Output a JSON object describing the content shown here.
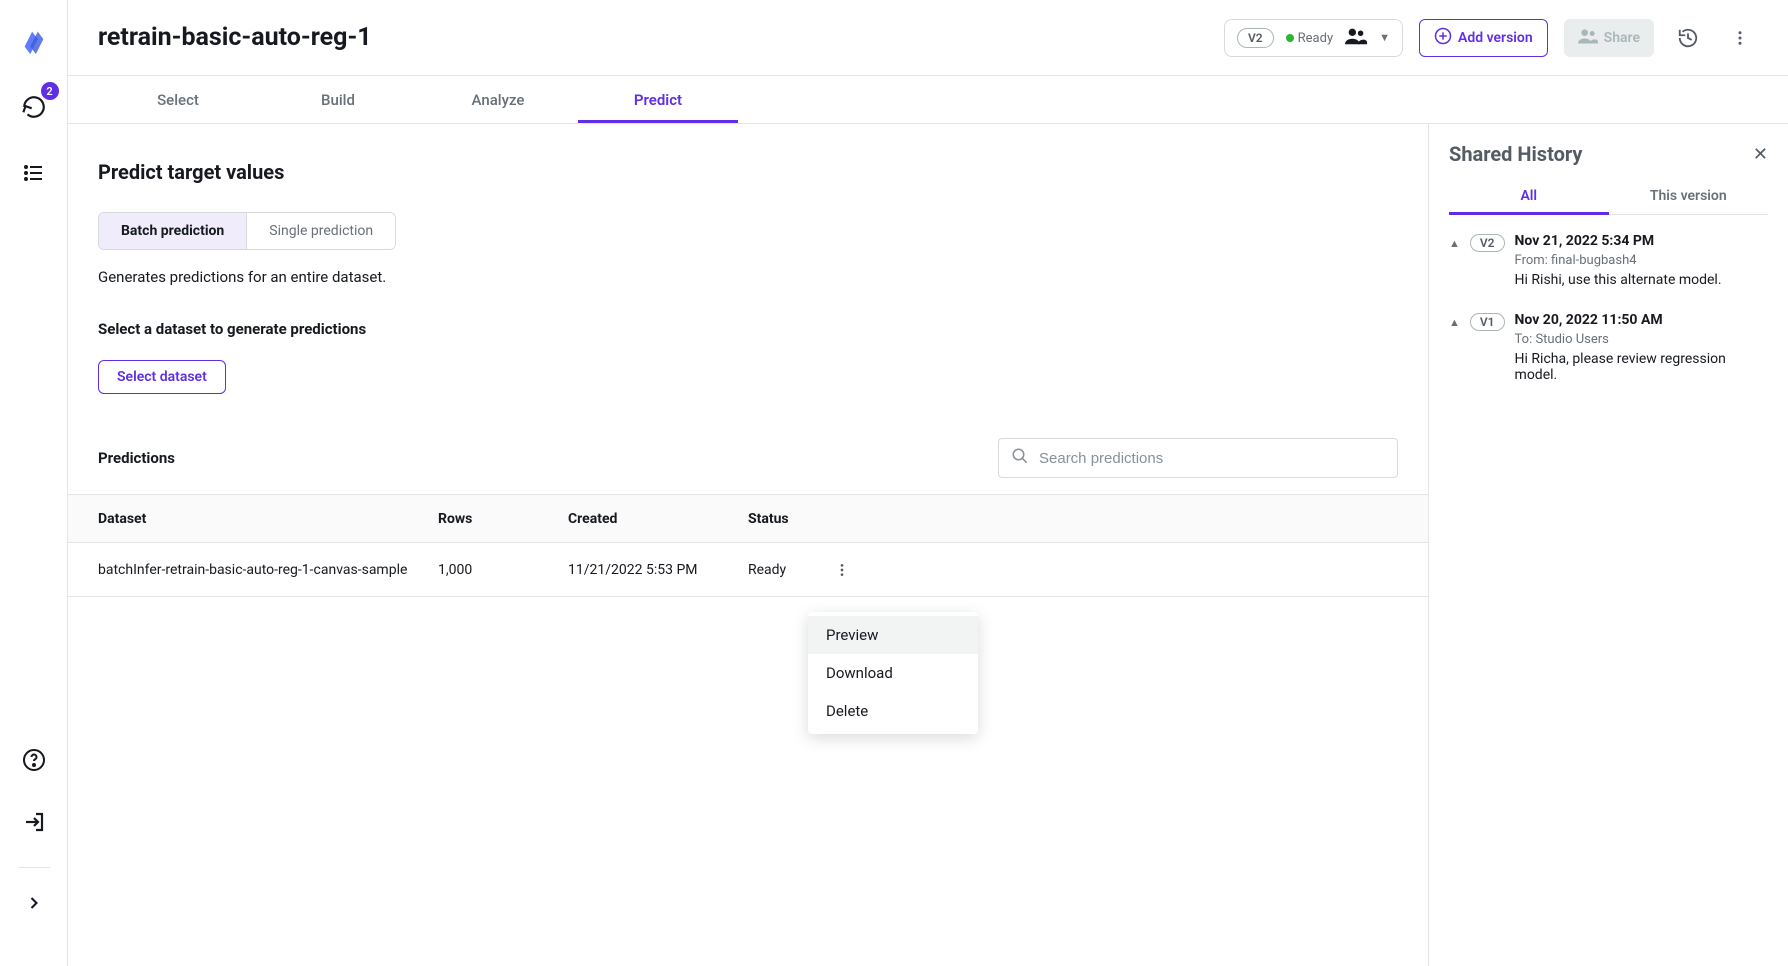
{
  "left_rail": {
    "badge": "2"
  },
  "header": {
    "title": "retrain-basic-auto-reg-1",
    "version_pill": "V2",
    "status": "Ready",
    "add_version": "Add version",
    "share": "Share"
  },
  "tabs": [
    {
      "label": "Select"
    },
    {
      "label": "Build"
    },
    {
      "label": "Analyze"
    },
    {
      "label": "Predict"
    }
  ],
  "main": {
    "title": "Predict target values",
    "toggle": {
      "batch": "Batch prediction",
      "single": "Single prediction"
    },
    "desc": "Generates predictions for an entire dataset.",
    "select_heading": "Select a dataset to generate predictions",
    "select_button": "Select dataset",
    "predictions_heading": "Predictions",
    "search_placeholder": "Search predictions",
    "columns": {
      "dataset": "Dataset",
      "rows": "Rows",
      "created": "Created",
      "status": "Status"
    },
    "rows": [
      {
        "dataset": "batchInfer-retrain-basic-auto-reg-1-canvas-sample",
        "rows": "1,000",
        "created": "11/21/2022 5:53 PM",
        "status": "Ready"
      }
    ],
    "row_menu": {
      "preview": "Preview",
      "download": "Download",
      "delete": "Delete"
    }
  },
  "right_panel": {
    "title": "Shared History",
    "tabs": {
      "all": "All",
      "this_version": "This version"
    },
    "items": [
      {
        "version": "V2",
        "date": "Nov 21, 2022 5:34 PM",
        "meta": "From: final-bugbash4",
        "msg": "Hi Rishi, use this alternate model."
      },
      {
        "version": "V1",
        "date": "Nov 20, 2022 11:50 AM",
        "meta": "To: Studio Users",
        "msg": "Hi Richa, please review regression model."
      }
    ]
  }
}
